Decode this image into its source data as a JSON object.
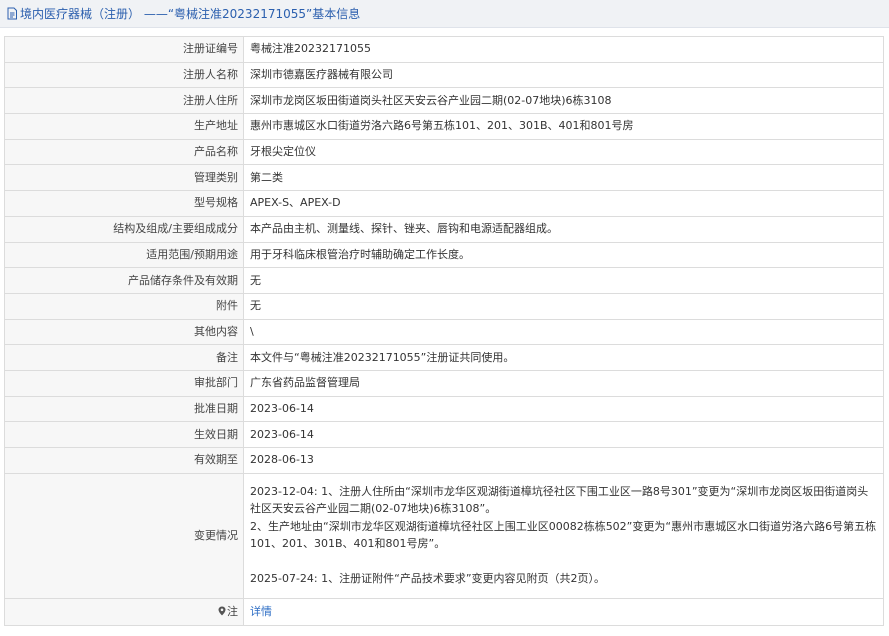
{
  "header": {
    "title": "境内医疗器械（注册）  ——“粤械注准20232171055”基本信息"
  },
  "rows": [
    {
      "label": "注册证编号",
      "value": "粤械注准20232171055"
    },
    {
      "label": "注册人名称",
      "value": "深圳市德嘉医疗器械有限公司"
    },
    {
      "label": "注册人住所",
      "value": "深圳市龙岗区坂田街道岗头社区天安云谷产业园二期(02-07地块)6栋3108"
    },
    {
      "label": "生产地址",
      "value": "惠州市惠城区水口街道労洛六路6号第五栋101、201、301B、401和801号房"
    },
    {
      "label": "产品名称",
      "value": "牙根尖定位仪"
    },
    {
      "label": "管理类别",
      "value": "第二类"
    },
    {
      "label": "型号规格",
      "value": "APEX-S、APEX-D"
    },
    {
      "label": "结构及组成/主要组成成分",
      "value": "本产品由主机、测量线、探针、锉夹、唇钩和电源适配器组成。"
    },
    {
      "label": "适用范围/预期用途",
      "value": "用于牙科临床根管治疗时辅助确定工作长度。"
    },
    {
      "label": "产品储存条件及有效期",
      "value": "无"
    },
    {
      "label": "附件",
      "value": "无"
    },
    {
      "label": "其他内容",
      "value": "\\"
    },
    {
      "label": "备注",
      "value": "本文件与“粤械注准20232171055”注册证共同使用。"
    },
    {
      "label": "审批部门",
      "value": "广东省药品监督管理局"
    },
    {
      "label": "批准日期",
      "value": "2023-06-14"
    },
    {
      "label": "生效日期",
      "value": "2023-06-14"
    },
    {
      "label": "有效期至",
      "value": "2028-06-13"
    }
  ],
  "changes": {
    "label": "变更情况",
    "line1": "2023-12-04: 1、注册人住所由“深圳市龙华区观湖街道樟坑径社区下围工业区一路8号301”变更为“深圳市龙岗区坂田街道岗头社区天安云谷产业园二期(02-07地块)6栋3108”。",
    "line2": "2、生产地址由“深圳市龙华区观湖街道樟坑径社区上围工业区00082栋栋502”变更为“惠州市惠城区水口街道労洛六路6号第五栋101、201、301B、401和801号房”。",
    "line3": "2025-07-24: 1、注册证附件“产品技术要求”变更内容见附页（共2页）。"
  },
  "note": {
    "label": "注",
    "link": "详情"
  },
  "colors": {
    "title": "#2b5fae",
    "link": "#2b6cc4",
    "label_bg": "#f7f7f7",
    "border": "#dcdcdc"
  }
}
